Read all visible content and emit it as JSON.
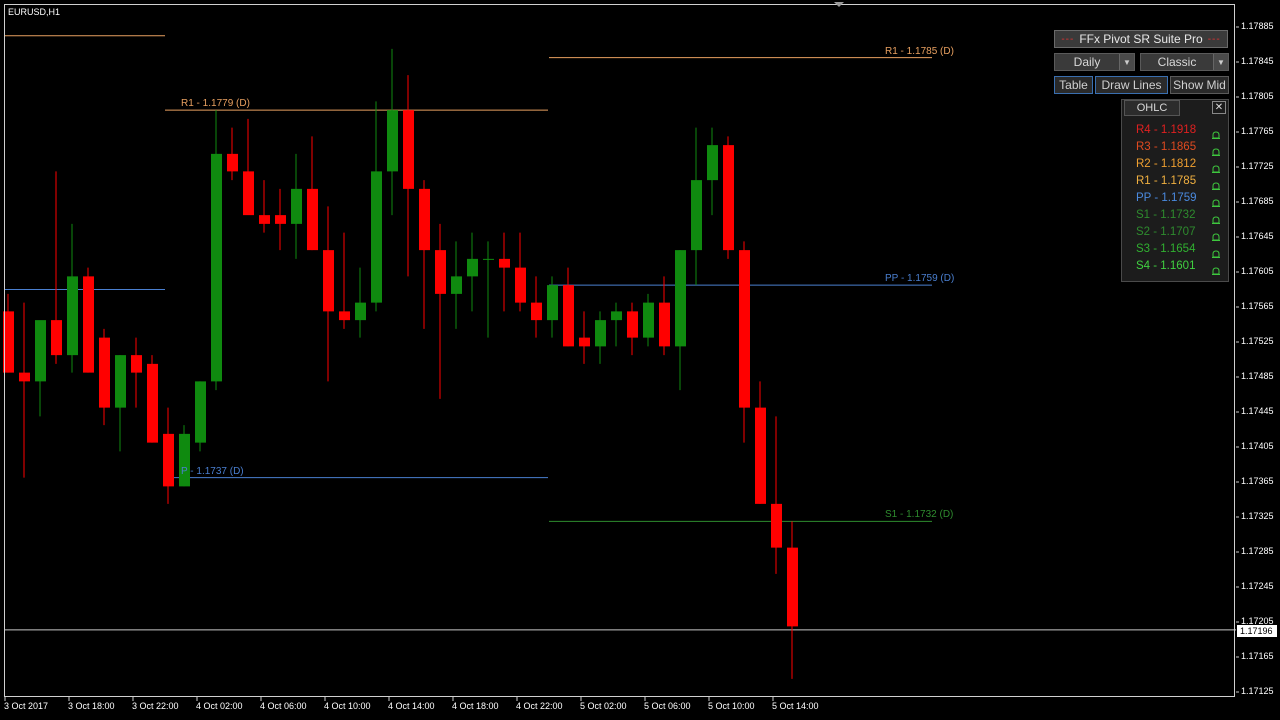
{
  "symbol": "EURUSD,H1",
  "panel": {
    "title": "FFx Pivot SR Suite Pro",
    "title_dash": "---",
    "period": "Daily",
    "method": "Classic",
    "buttons": [
      "Table",
      "Draw Lines",
      "Show Mid"
    ],
    "ohlc_label": "OHLC",
    "close_glyph": "✕"
  },
  "levels": [
    {
      "label": "R4 - 1.1918",
      "color": "#e02020"
    },
    {
      "label": "R3 - 1.1865",
      "color": "#e04a20"
    },
    {
      "label": "R2 - 1.1812",
      "color": "#f0a030"
    },
    {
      "label": "R1 - 1.1785",
      "color": "#f0b040"
    },
    {
      "label": "PP - 1.1759",
      "color": "#4a8adf"
    },
    {
      "label": "S1 - 1.1732",
      "color": "#2e8b2e"
    },
    {
      "label": "S2 - 1.1707",
      "color": "#2e8b2e"
    },
    {
      "label": "S3 - 1.1654",
      "color": "#30b030"
    },
    {
      "label": "S4 - 1.1601",
      "color": "#40d040"
    }
  ],
  "chart_lines": {
    "r1_oct4": {
      "label": "R1 - 1.1779 (D)",
      "price": 1.1779
    },
    "p_oct4": {
      "label": "P - 1.1737 (D)",
      "price": 1.1737
    },
    "r1_oct5": {
      "label": "R1 - 1.1785 (D)",
      "price": 1.1785
    },
    "pp_oct5": {
      "label": "PP - 1.1759 (D)",
      "price": 1.1759
    },
    "s1_oct5": {
      "label": "S1 - 1.1732 (D)",
      "price": 1.1732
    }
  },
  "current_price": "1.17196",
  "price_ticks": [
    "1.17885",
    "1.17845",
    "1.17805",
    "1.17765",
    "1.17725",
    "1.17685",
    "1.17645",
    "1.17605",
    "1.17565",
    "1.17525",
    "1.17485",
    "1.17445",
    "1.17405",
    "1.17365",
    "1.17325",
    "1.17285",
    "1.17245",
    "1.17205",
    "1.17165",
    "1.17125"
  ],
  "time_ticks": [
    "3 Oct 2017",
    "3 Oct 18:00",
    "3 Oct 22:00",
    "4 Oct 02:00",
    "4 Oct 06:00",
    "4 Oct 10:00",
    "4 Oct 14:00",
    "4 Oct 18:00",
    "4 Oct 22:00",
    "5 Oct 02:00",
    "5 Oct 06:00",
    "5 Oct 10:00",
    "5 Oct 14:00"
  ],
  "colors": {
    "bull": "#0f8a0f",
    "bear": "#ff0000",
    "r1": "#e8a060",
    "pp": "#4a7fd0",
    "s1": "#2e8b2e"
  },
  "chart_data": {
    "type": "candlestick",
    "ylim": [
      1.1711,
      1.1791
    ],
    "candles": [
      {
        "o": 1.1756,
        "h": 1.1758,
        "l": 1.1749,
        "c": 1.1749
      },
      {
        "o": 1.1749,
        "h": 1.1757,
        "l": 1.1737,
        "c": 1.1748
      },
      {
        "o": 1.1748,
        "h": 1.1754,
        "l": 1.1744,
        "c": 1.1755
      },
      {
        "o": 1.1755,
        "h": 1.1772,
        "l": 1.175,
        "c": 1.1751
      },
      {
        "o": 1.1751,
        "h": 1.1766,
        "l": 1.1749,
        "c": 1.176
      },
      {
        "o": 1.176,
        "h": 1.1761,
        "l": 1.1749,
        "c": 1.1749
      },
      {
        "o": 1.1753,
        "h": 1.1754,
        "l": 1.1743,
        "c": 1.1745
      },
      {
        "o": 1.1745,
        "h": 1.1751,
        "l": 1.174,
        "c": 1.1751
      },
      {
        "o": 1.1751,
        "h": 1.1753,
        "l": 1.1745,
        "c": 1.1749
      },
      {
        "o": 1.175,
        "h": 1.1751,
        "l": 1.1741,
        "c": 1.1741
      },
      {
        "o": 1.1742,
        "h": 1.1745,
        "l": 1.1734,
        "c": 1.1736
      },
      {
        "o": 1.1736,
        "h": 1.1743,
        "l": 1.1736,
        "c": 1.1742
      },
      {
        "o": 1.1741,
        "h": 1.1748,
        "l": 1.174,
        "c": 1.1748
      },
      {
        "o": 1.1748,
        "h": 1.1779,
        "l": 1.1747,
        "c": 1.1774
      },
      {
        "o": 1.1774,
        "h": 1.1777,
        "l": 1.1771,
        "c": 1.1772
      },
      {
        "o": 1.1772,
        "h": 1.1778,
        "l": 1.1768,
        "c": 1.1767
      },
      {
        "o": 1.1767,
        "h": 1.1771,
        "l": 1.1765,
        "c": 1.1766
      },
      {
        "o": 1.1767,
        "h": 1.177,
        "l": 1.1763,
        "c": 1.1766
      },
      {
        "o": 1.1766,
        "h": 1.1774,
        "l": 1.1762,
        "c": 1.177
      },
      {
        "o": 1.177,
        "h": 1.1776,
        "l": 1.1763,
        "c": 1.1763
      },
      {
        "o": 1.1763,
        "h": 1.1768,
        "l": 1.1748,
        "c": 1.1756
      },
      {
        "o": 1.1756,
        "h": 1.1765,
        "l": 1.1754,
        "c": 1.1755
      },
      {
        "o": 1.1755,
        "h": 1.1761,
        "l": 1.1753,
        "c": 1.1757
      },
      {
        "o": 1.1757,
        "h": 1.178,
        "l": 1.1756,
        "c": 1.1772
      },
      {
        "o": 1.1772,
        "h": 1.1786,
        "l": 1.1767,
        "c": 1.1779
      },
      {
        "o": 1.1779,
        "h": 1.1783,
        "l": 1.176,
        "c": 1.177
      },
      {
        "o": 1.177,
        "h": 1.1771,
        "l": 1.1754,
        "c": 1.1763
      },
      {
        "o": 1.1763,
        "h": 1.1766,
        "l": 1.1746,
        "c": 1.1758
      },
      {
        "o": 1.1758,
        "h": 1.1764,
        "l": 1.1754,
        "c": 1.176
      },
      {
        "o": 1.176,
        "h": 1.1765,
        "l": 1.1756,
        "c": 1.1762
      },
      {
        "o": 1.1762,
        "h": 1.1764,
        "l": 1.1753,
        "c": 1.1762
      },
      {
        "o": 1.1762,
        "h": 1.1765,
        "l": 1.1756,
        "c": 1.1761
      },
      {
        "o": 1.1761,
        "h": 1.1765,
        "l": 1.1756,
        "c": 1.1757
      },
      {
        "o": 1.1757,
        "h": 1.176,
        "l": 1.1753,
        "c": 1.1755
      },
      {
        "o": 1.1755,
        "h": 1.176,
        "l": 1.1753,
        "c": 1.1759
      },
      {
        "o": 1.1759,
        "h": 1.1761,
        "l": 1.1752,
        "c": 1.1752
      },
      {
        "o": 1.1753,
        "h": 1.1756,
        "l": 1.175,
        "c": 1.1752
      },
      {
        "o": 1.1752,
        "h": 1.1756,
        "l": 1.175,
        "c": 1.1755
      },
      {
        "o": 1.1755,
        "h": 1.1757,
        "l": 1.1752,
        "c": 1.1756
      },
      {
        "o": 1.1756,
        "h": 1.1757,
        "l": 1.1751,
        "c": 1.1753
      },
      {
        "o": 1.1753,
        "h": 1.1758,
        "l": 1.1752,
        "c": 1.1757
      },
      {
        "o": 1.1757,
        "h": 1.176,
        "l": 1.1751,
        "c": 1.1752
      },
      {
        "o": 1.1752,
        "h": 1.1763,
        "l": 1.1747,
        "c": 1.1763
      },
      {
        "o": 1.1763,
        "h": 1.1777,
        "l": 1.1759,
        "c": 1.1771
      },
      {
        "o": 1.1771,
        "h": 1.1777,
        "l": 1.1767,
        "c": 1.1775
      },
      {
        "o": 1.1775,
        "h": 1.1776,
        "l": 1.1762,
        "c": 1.1763
      },
      {
        "o": 1.1763,
        "h": 1.1764,
        "l": 1.1741,
        "c": 1.1745
      },
      {
        "o": 1.1745,
        "h": 1.1748,
        "l": 1.1734,
        "c": 1.1734
      },
      {
        "o": 1.1734,
        "h": 1.1744,
        "l": 1.1726,
        "c": 1.1729
      },
      {
        "o": 1.1729,
        "h": 1.1732,
        "l": 1.1714,
        "c": 1.172
      }
    ]
  }
}
